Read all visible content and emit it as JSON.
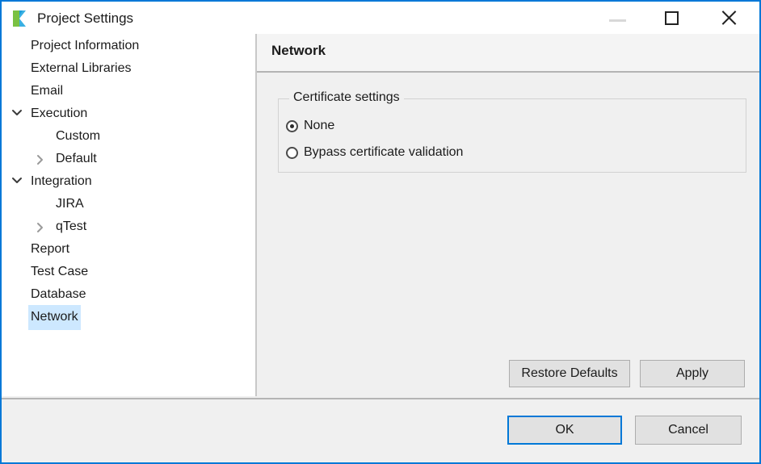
{
  "window": {
    "title": "Project Settings",
    "logo_icon": "katalon-logo-icon",
    "border_color": "#0078d7",
    "controls": {
      "minimize_label": "—",
      "minimize_icon": "minimize-icon",
      "maximize_label": "□",
      "maximize_icon": "maximize-icon",
      "close_label": "✕",
      "close_icon": "close-icon"
    }
  },
  "sidebar": {
    "selection_color": "#cde8ff",
    "items": [
      {
        "label": "Project Information",
        "level": 0,
        "arrow": "none",
        "selected": false
      },
      {
        "label": "External Libraries",
        "level": 0,
        "arrow": "none",
        "selected": false
      },
      {
        "label": "Email",
        "level": 0,
        "arrow": "none",
        "selected": false
      },
      {
        "label": "Execution",
        "level": 0,
        "arrow": "down",
        "selected": false
      },
      {
        "label": "Custom",
        "level": 1,
        "arrow": "none",
        "selected": false
      },
      {
        "label": "Default",
        "level": 1,
        "arrow": "right",
        "selected": false
      },
      {
        "label": "Integration",
        "level": 0,
        "arrow": "down",
        "selected": false
      },
      {
        "label": "JIRA",
        "level": 1,
        "arrow": "none",
        "selected": false
      },
      {
        "label": "qTest",
        "level": 1,
        "arrow": "right",
        "selected": false
      },
      {
        "label": "Report",
        "level": 0,
        "arrow": "none",
        "selected": false
      },
      {
        "label": "Test Case",
        "level": 0,
        "arrow": "none",
        "selected": false
      },
      {
        "label": "Database",
        "level": 0,
        "arrow": "none",
        "selected": false
      },
      {
        "label": "Network",
        "level": 0,
        "arrow": "none",
        "selected": true
      }
    ]
  },
  "content": {
    "pane_title": "Network",
    "certificate_group": {
      "legend": "Certificate settings",
      "options": [
        {
          "label": "None",
          "selected": true
        },
        {
          "label": "Bypass certificate validation",
          "selected": false
        }
      ]
    },
    "restore_defaults_label": "Restore Defaults",
    "apply_label": "Apply"
  },
  "footer": {
    "ok_label": "OK",
    "cancel_label": "Cancel",
    "ok_focus_color": "#0078d7"
  }
}
